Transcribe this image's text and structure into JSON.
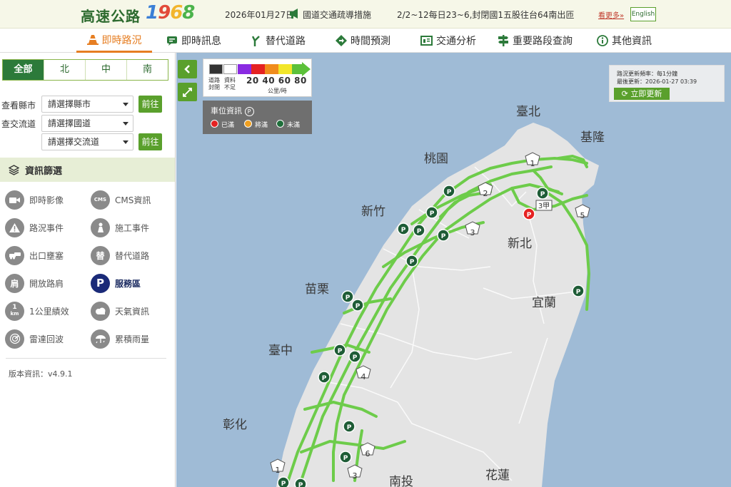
{
  "header": {
    "logo_text": "高速公路",
    "logo_number": "1968",
    "news_date": "2026年01月27日",
    "news_title": "國道交通疏導措施",
    "news_text": "2/2~12每日23~6,封閉國1五股往台64南出匝",
    "more_link": "看更多»",
    "english_label": "English"
  },
  "nav": {
    "items": [
      {
        "label": "即時路況",
        "icon": "traffic-cone-icon"
      },
      {
        "label": "即時訊息",
        "icon": "message-icon"
      },
      {
        "label": "替代道路",
        "icon": "road-fork-icon"
      },
      {
        "label": "時間預測",
        "icon": "diamond-arrow-icon"
      },
      {
        "label": "交通分析",
        "icon": "chart-card-icon"
      },
      {
        "label": "重要路段查詢",
        "icon": "signpost-icon"
      },
      {
        "label": "其他資訊",
        "icon": "info-icon"
      }
    ]
  },
  "sidebar": {
    "region_tabs": [
      "全部",
      "北",
      "中",
      "南"
    ],
    "city_label": "查看縣市",
    "city_select": "請選擇縣市",
    "interchange_label": "查交流道",
    "highway_select": "請選擇國道",
    "interchange_select": "請選擇交流道",
    "go_label": "前往",
    "filter_title": "資訊篩選",
    "filters": [
      {
        "label": "即時影像",
        "icon": "camera-icon"
      },
      {
        "label": "CMS資訊",
        "icon": "cms-sign-icon"
      },
      {
        "label": "路況事件",
        "icon": "warning-icon"
      },
      {
        "label": "施工事件",
        "icon": "construction-worker-icon"
      },
      {
        "label": "出口壅塞",
        "icon": "car-jam-icon"
      },
      {
        "label": "替代道路",
        "icon": "alternate-road-icon"
      },
      {
        "label": "開放路肩",
        "icon": "shoulder-icon"
      },
      {
        "label": "服務區",
        "icon": "parking-icon"
      },
      {
        "label": "1公里績效",
        "icon": "km-icon"
      },
      {
        "label": "天氣資訊",
        "icon": "weather-icon"
      },
      {
        "label": "雷達回波",
        "icon": "radar-icon"
      },
      {
        "label": "累積雨量",
        "icon": "rainfall-icon"
      }
    ],
    "filter_icon_text": {
      "cms": "CMS",
      "alt": "替",
      "shoulder": "肩",
      "parking": "P",
      "km_top": "1",
      "km_bottom": "km"
    },
    "version": "版本資訊：v4.9.1"
  },
  "map": {
    "legend": {
      "colors": [
        "#333333",
        "#ffffff",
        "#8a2be2",
        "#e52222",
        "#f08c1c",
        "#f2e62a",
        "#5cc13a"
      ],
      "no_data_1": "道路",
      "no_data_2": "封閉",
      "no_data_3": "資料",
      "no_data_4": "不足",
      "speeds": "20 40 60 80",
      "unit": "公里/時"
    },
    "parking": {
      "title": "車位資訊",
      "icon_text": "P",
      "full": "已滿",
      "almost": "將滿",
      "available": "未滿",
      "colors": {
        "full": "#e52222",
        "almost": "#f0a020",
        "available": "#1e6e3a"
      }
    },
    "update": {
      "freq": "路況更新頻率：每1分鐘",
      "last": "最後更新：2026-01-27 03:39",
      "refresh": "立即更新"
    },
    "cities": [
      "臺北",
      "基隆",
      "桃園",
      "新竹",
      "新北",
      "苗栗",
      "宜蘭",
      "臺中",
      "彰化",
      "南投",
      "花蓮"
    ],
    "highway_shields": [
      "1",
      "2",
      "3",
      "5",
      "3",
      "4",
      "6",
      "3",
      "1",
      "3甲"
    ],
    "service_marker_text": "P",
    "road_color": "#6dcc4a"
  }
}
